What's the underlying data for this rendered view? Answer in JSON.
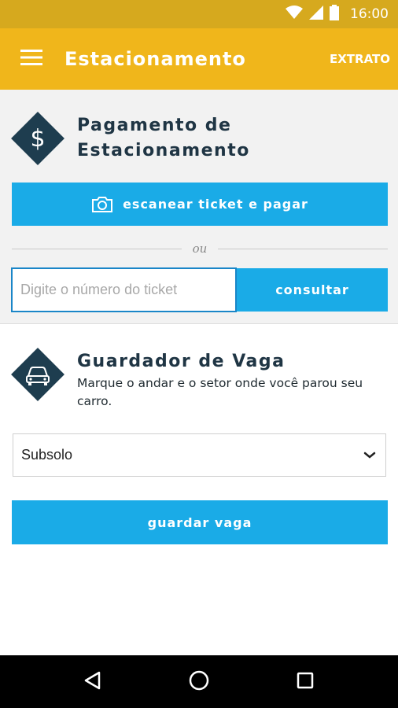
{
  "status_bar": {
    "time": "16:00"
  },
  "app_bar": {
    "title": "Estacionamento",
    "action": "EXTRATO"
  },
  "payment": {
    "title_line1": "Pagamento de",
    "title_line2": "Estacionamento",
    "scan_button": "escanear ticket e pagar",
    "separator": "ou",
    "ticket_placeholder": "Digite o número do ticket",
    "consult_button": "consultar"
  },
  "guard": {
    "title": "Guardador de Vaga",
    "description": "Marque o andar e o setor onde você parou seu carro.",
    "floor_selected": "Subsolo",
    "save_button": "guardar vaga"
  },
  "colors": {
    "app_bar": "#f0b61b",
    "status_bar": "#d6a91e",
    "primary_button": "#1aabe7",
    "icon_diamond": "#1e3d4f"
  },
  "icons": [
    "wifi-icon",
    "signal-icon",
    "battery-icon",
    "menu-icon",
    "dollar-icon",
    "camera-icon",
    "car-icon",
    "chevron-down-icon",
    "back-icon",
    "home-icon",
    "recents-icon"
  ]
}
